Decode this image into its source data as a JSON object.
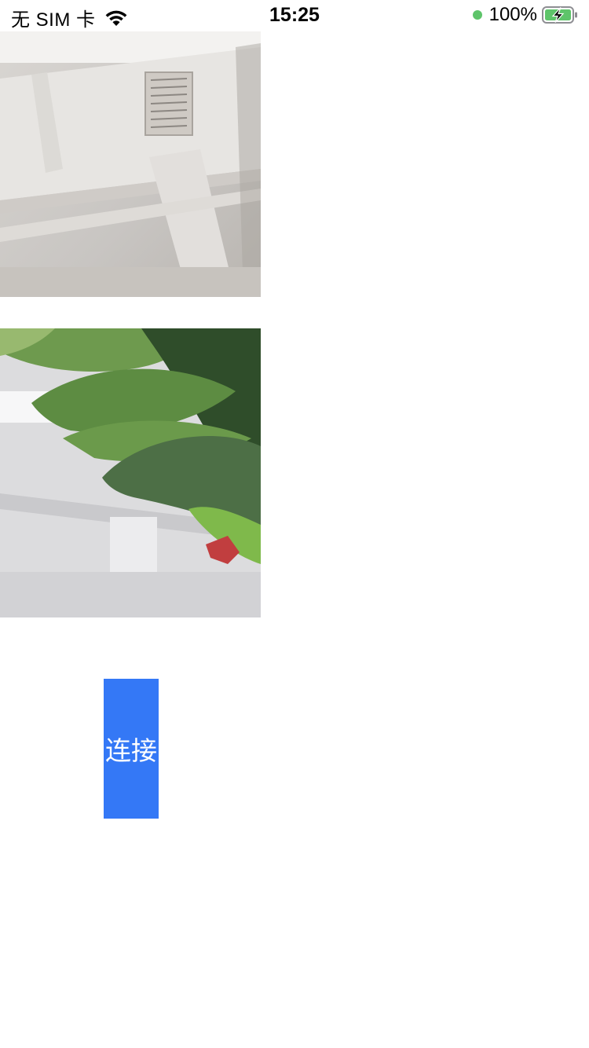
{
  "status_bar": {
    "carrier": "无 SIM 卡",
    "time": "15:25",
    "battery_percent": "100%",
    "battery_level": 1.0,
    "charging": true,
    "icons": [
      "wifi-icon",
      "green-dot-icon",
      "battery-charging-icon"
    ]
  },
  "photos": [
    {
      "description_icon": "ceiling-duct-photo"
    },
    {
      "description_icon": "plant-leaves-photo"
    }
  ],
  "connect_button": {
    "label": "连接",
    "color": "#3478f6"
  },
  "colors": {
    "accent": "#3478f6",
    "status_green": "#5ec46a"
  }
}
